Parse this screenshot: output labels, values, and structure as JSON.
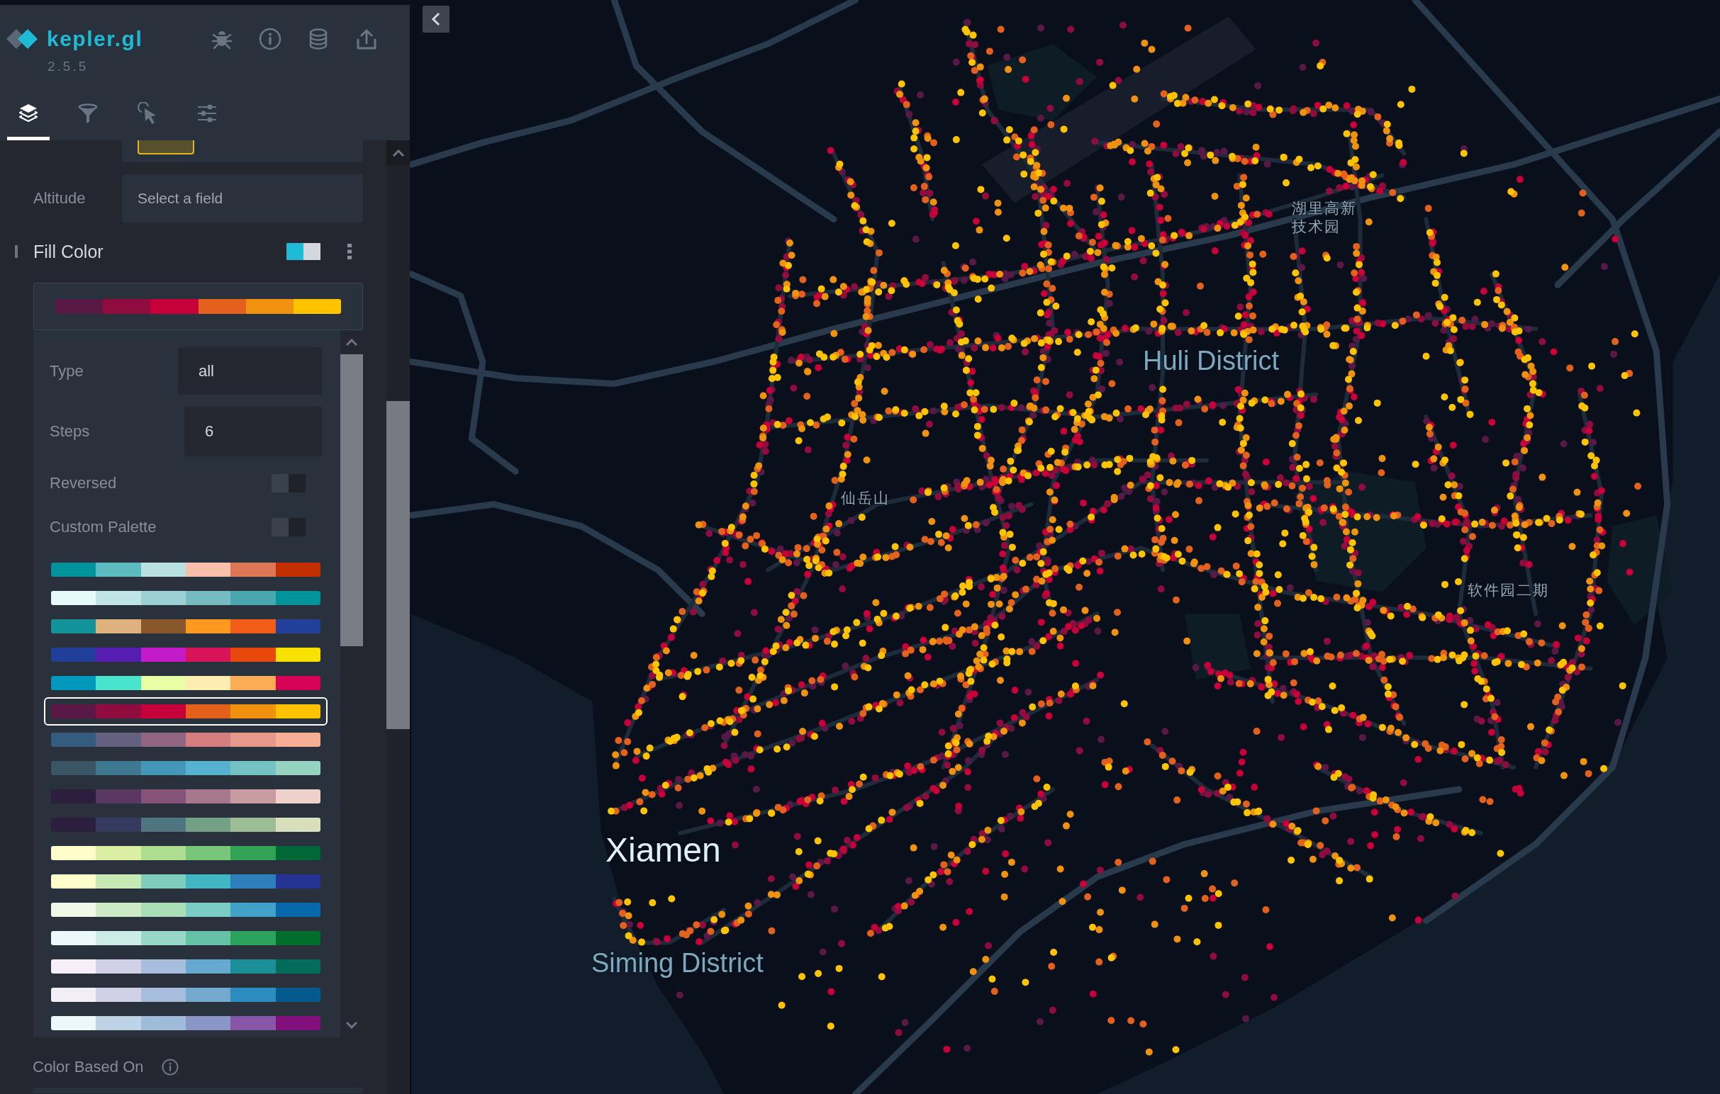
{
  "app": {
    "name": "kepler.gl",
    "version": "2.5.5"
  },
  "header_actions": [
    {
      "kind": "bug"
    },
    {
      "kind": "info"
    },
    {
      "kind": "database"
    },
    {
      "kind": "share"
    }
  ],
  "tabs": [
    {
      "kind": "layers",
      "selected": true
    },
    {
      "kind": "filters",
      "selected": false
    },
    {
      "kind": "interactions",
      "selected": false
    },
    {
      "kind": "settings",
      "selected": false
    }
  ],
  "altitude": {
    "label": "Altitude",
    "placeholder": "Select a field"
  },
  "fill_color": {
    "label": "Fill Color",
    "on": true
  },
  "color_range": {
    "current": [
      {
        "color": "#5a1846"
      },
      {
        "color": "#900c3f"
      },
      {
        "color": "#c70039"
      },
      {
        "color": "#e3611c"
      },
      {
        "color": "#f1920e"
      },
      {
        "color": "#ffc300"
      }
    ],
    "type_label": "Type",
    "type_value": "all",
    "steps_label": "Steps",
    "steps_value": "6",
    "reversed": {
      "label": "Reversed",
      "on": false
    },
    "custom_palette": {
      "label": "Custom Palette",
      "on": false
    },
    "palettes": [
      {
        "swatches": [
          {
            "color": "#00939c"
          },
          {
            "color": "#5dbabf"
          },
          {
            "color": "#bae1e2"
          },
          {
            "color": "#f8c0aa"
          },
          {
            "color": "#dd7755"
          },
          {
            "color": "#c22e00"
          }
        ],
        "selected": false
      },
      {
        "swatches": [
          {
            "color": "#e6fafa"
          },
          {
            "color": "#c1e5e6"
          },
          {
            "color": "#9dd0d4"
          },
          {
            "color": "#75bbc1"
          },
          {
            "color": "#4ba7af"
          },
          {
            "color": "#00939c"
          }
        ],
        "selected": false
      },
      {
        "swatches": [
          {
            "color": "#12939a"
          },
          {
            "color": "#ddb27c"
          },
          {
            "color": "#88572c"
          },
          {
            "color": "#ff991f"
          },
          {
            "color": "#f15c17"
          },
          {
            "color": "#223f9a"
          }
        ],
        "selected": false
      },
      {
        "swatches": [
          {
            "color": "#213e9a"
          },
          {
            "color": "#551eb1"
          },
          {
            "color": "#c21bc7"
          },
          {
            "color": "#d71458"
          },
          {
            "color": "#e8480a"
          },
          {
            "color": "#f9e200"
          }
        ],
        "selected": false
      },
      {
        "swatches": [
          {
            "color": "#0198bd"
          },
          {
            "color": "#49e3ce"
          },
          {
            "color": "#e8fea5"
          },
          {
            "color": "#feedb1"
          },
          {
            "color": "#feac54"
          },
          {
            "color": "#d50255"
          }
        ],
        "selected": false
      },
      {
        "swatches": [
          {
            "color": "#5a1846"
          },
          {
            "color": "#900c3f"
          },
          {
            "color": "#c70039"
          },
          {
            "color": "#e3611c"
          },
          {
            "color": "#f1920e"
          },
          {
            "color": "#ffc300"
          }
        ],
        "selected": true
      },
      {
        "swatches": [
          {
            "color": "#355c7d"
          },
          {
            "color": "#63617f"
          },
          {
            "color": "#916681"
          },
          {
            "color": "#d47e80"
          },
          {
            "color": "#e6998b"
          },
          {
            "color": "#f6ae94"
          }
        ],
        "selected": false
      },
      {
        "swatches": [
          {
            "color": "#3a5563"
          },
          {
            "color": "#3e7891"
          },
          {
            "color": "#4597b9"
          },
          {
            "color": "#56b2ce"
          },
          {
            "color": "#74c2c5"
          },
          {
            "color": "#96d3c0"
          }
        ],
        "selected": false
      },
      {
        "swatches": [
          {
            "color": "#2c1e3d"
          },
          {
            "color": "#5a3864"
          },
          {
            "color": "#855378"
          },
          {
            "color": "#a7778c"
          },
          {
            "color": "#c99ba1"
          },
          {
            "color": "#edd1ca"
          }
        ],
        "selected": false
      },
      {
        "swatches": [
          {
            "color": "#2c1e3d"
          },
          {
            "color": "#353b5f"
          },
          {
            "color": "#4f7580"
          },
          {
            "color": "#74a085"
          },
          {
            "color": "#9cbd95"
          },
          {
            "color": "#d8dfbd"
          }
        ],
        "selected": false
      },
      {
        "swatches": [
          {
            "color": "#ffffcc"
          },
          {
            "color": "#d9f0a3"
          },
          {
            "color": "#addd8e"
          },
          {
            "color": "#78c679"
          },
          {
            "color": "#31a354"
          },
          {
            "color": "#006837"
          }
        ],
        "selected": false
      },
      {
        "swatches": [
          {
            "color": "#ffffcc"
          },
          {
            "color": "#c7e9b4"
          },
          {
            "color": "#7fcdbb"
          },
          {
            "color": "#41b6c4"
          },
          {
            "color": "#2c7fb8"
          },
          {
            "color": "#253494"
          }
        ],
        "selected": false
      },
      {
        "swatches": [
          {
            "color": "#f0f9e8"
          },
          {
            "color": "#ccebc5"
          },
          {
            "color": "#a8ddb5"
          },
          {
            "color": "#7bccc4"
          },
          {
            "color": "#43a2ca"
          },
          {
            "color": "#0868ac"
          }
        ],
        "selected": false
      },
      {
        "swatches": [
          {
            "color": "#edf8fb"
          },
          {
            "color": "#ccece6"
          },
          {
            "color": "#99d8c9"
          },
          {
            "color": "#66c2a4"
          },
          {
            "color": "#2ca25f"
          },
          {
            "color": "#006d2c"
          }
        ],
        "selected": false
      },
      {
        "swatches": [
          {
            "color": "#f6eff7"
          },
          {
            "color": "#d0d1e6"
          },
          {
            "color": "#a6bddb"
          },
          {
            "color": "#67a9cf"
          },
          {
            "color": "#1c9099"
          },
          {
            "color": "#016c59"
          }
        ],
        "selected": false
      },
      {
        "swatches": [
          {
            "color": "#f1eef6"
          },
          {
            "color": "#d0d1e6"
          },
          {
            "color": "#a6bddb"
          },
          {
            "color": "#74a9cf"
          },
          {
            "color": "#2b8cbe"
          },
          {
            "color": "#045a8d"
          }
        ],
        "selected": false
      },
      {
        "swatches": [
          {
            "color": "#edf8fb"
          },
          {
            "color": "#bfd3e6"
          },
          {
            "color": "#9ebcda"
          },
          {
            "color": "#8c96c6"
          },
          {
            "color": "#8856a7"
          },
          {
            "color": "#810f7c"
          }
        ],
        "selected": false
      }
    ]
  },
  "color_based_on": {
    "label": "Color Based On"
  },
  "map": {
    "point_series": [
      {
        "color": "#5a1846"
      },
      {
        "color": "#900c3f"
      },
      {
        "color": "#c70039"
      },
      {
        "color": "#e3611c"
      },
      {
        "color": "#f1920e"
      },
      {
        "color": "#ffc300"
      }
    ],
    "labels": [
      {
        "text": "湖里高新技术园",
        "kind": "place"
      },
      {
        "text": "Huli District",
        "kind": "district"
      },
      {
        "text": "仙岳山",
        "kind": "place"
      },
      {
        "text": "软件园二期",
        "kind": "place"
      },
      {
        "text": "Xiamen",
        "kind": "city"
      },
      {
        "text": "Siming District",
        "kind": "district"
      }
    ]
  }
}
